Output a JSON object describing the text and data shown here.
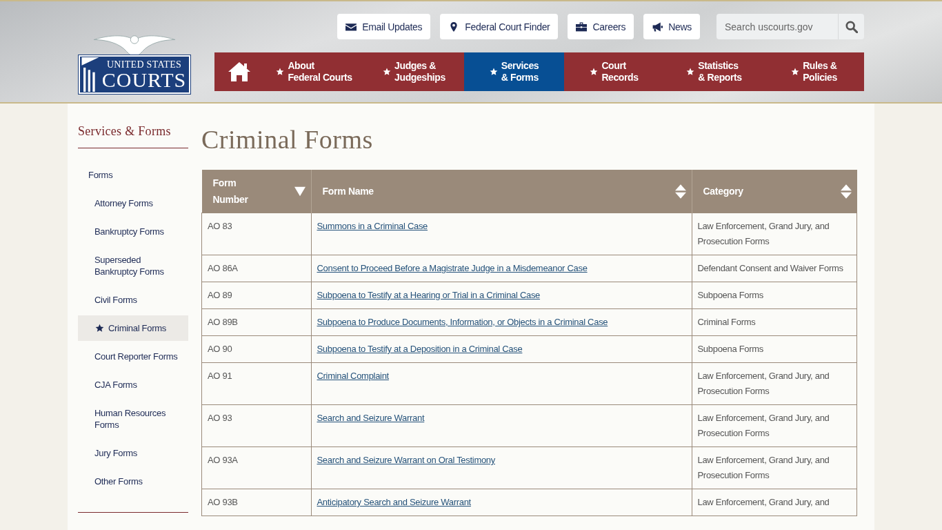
{
  "logo": {
    "line_1": "UNITED STATES",
    "line_2": "COURTS"
  },
  "utility_links": [
    {
      "label": "Email Updates"
    },
    {
      "label": "Federal Court Finder"
    },
    {
      "label": "Careers"
    },
    {
      "label": "News"
    }
  ],
  "search": {
    "placeholder": "Search uscourts.gov"
  },
  "nav": [
    {
      "label": "About\nFederal Courts",
      "selected": false
    },
    {
      "label": "Judges &\nJudgeships",
      "selected": false
    },
    {
      "label": "Services\n& Forms",
      "selected": true
    },
    {
      "label": "Court\nRecords",
      "selected": false
    },
    {
      "label": "Statistics\n& Reports",
      "selected": false
    },
    {
      "label": "Rules &\nPolicies",
      "selected": false
    }
  ],
  "sidebar": {
    "title": "Services & Forms",
    "items": [
      {
        "label": "Forms",
        "selected": false,
        "children": [
          {
            "label": "Attorney Forms",
            "selected": false
          },
          {
            "label": "Bankruptcy Forms",
            "selected": false
          },
          {
            "label": "Superseded\nBankruptcy Forms",
            "selected": false
          },
          {
            "label": "Civil Forms",
            "selected": false
          },
          {
            "label": "Criminal Forms",
            "selected": true
          },
          {
            "label": "Court Reporter Forms",
            "selected": false
          },
          {
            "label": "CJA Forms",
            "selected": false
          },
          {
            "label": "Human Resources\nForms",
            "selected": false
          },
          {
            "label": "Jury Forms",
            "selected": false
          },
          {
            "label": "Other Forms",
            "selected": false
          }
        ]
      }
    ]
  },
  "page_title": "Criminal Forms",
  "table": {
    "columns": [
      {
        "label": "Form\nNumber",
        "sorted": true
      },
      {
        "label": "Form Name",
        "sorted": false
      },
      {
        "label": "Category",
        "sorted": false
      }
    ],
    "rows": [
      [
        "AO 83",
        "Summons in a Criminal Case",
        "Law Enforcement, Grand Jury, and Prosecution Forms"
      ],
      [
        "AO 86A",
        "Consent to Proceed Before a Magistrate Judge in a Misdemeanor Case",
        "Defendant Consent and Waiver Forms"
      ],
      [
        "AO 89",
        "Subpoena to Testify at a Hearing or Trial in a Criminal Case",
        "Subpoena Forms"
      ],
      [
        "AO 89B",
        "Subpoena to Produce Documents, Information, or Objects in a Criminal Case",
        "Criminal Forms"
      ],
      [
        "AO 90",
        "Subpoena to Testify at a Deposition in a Criminal Case",
        "Subpoena Forms"
      ],
      [
        "AO 91",
        "Criminal Complaint",
        "Law Enforcement, Grand Jury, and Prosecution Forms"
      ],
      [
        "AO 93",
        "Search and Seizure Warrant",
        "Law Enforcement, Grand Jury, and Prosecution Forms"
      ],
      [
        "AO 93A",
        "Search and Seizure Warrant on Oral Testimony",
        "Law Enforcement, Grand Jury, and Prosecution Forms"
      ],
      [
        "AO 93B",
        "Anticipatory Search and Seizure Warrant",
        "Law Enforcement, Grand Jury, and"
      ]
    ]
  }
}
